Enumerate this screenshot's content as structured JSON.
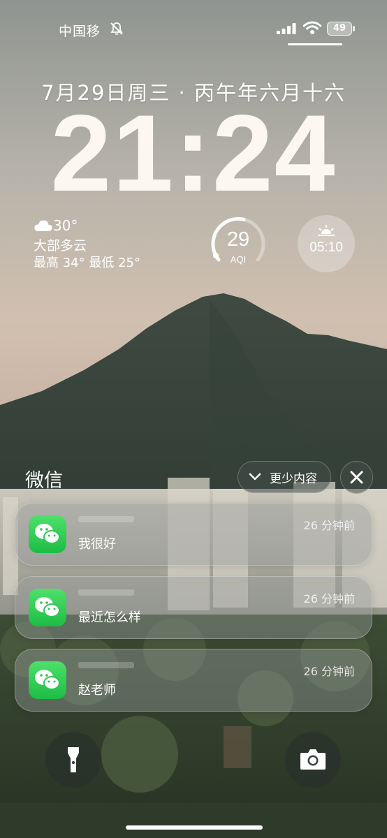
{
  "status_bar": {
    "carrier": "中国移",
    "battery": "49",
    "icons": [
      "bell-slash-icon",
      "signal-icon",
      "wifi-icon",
      "battery-icon"
    ]
  },
  "lock_screen": {
    "date": "7月29日周三 · 丙午年六月十六",
    "time": "21:24"
  },
  "weather": {
    "icon": "cloud-icon",
    "temperature": "30°",
    "condition": "大部多云",
    "range": "最高 34° 最低 25°"
  },
  "aqi": {
    "value": "29",
    "label": "AQI",
    "level": 0.55
  },
  "sunrise": {
    "icon": "sunrise-icon",
    "time": "05:10"
  },
  "notifications": {
    "app_name": "微信",
    "show_less_label": "更少内容",
    "items": [
      {
        "message": "我很好",
        "time": "26 分钟前"
      },
      {
        "message": "最近怎么样",
        "time": "26 分钟前"
      },
      {
        "message": "赵老师",
        "time": "26 分钟前"
      }
    ]
  },
  "quick_actions": {
    "left": "flashlight-icon",
    "right": "camera-icon"
  },
  "colors": {
    "wechat_green": "#1dbd45",
    "time_color": "#fdf8ef"
  }
}
